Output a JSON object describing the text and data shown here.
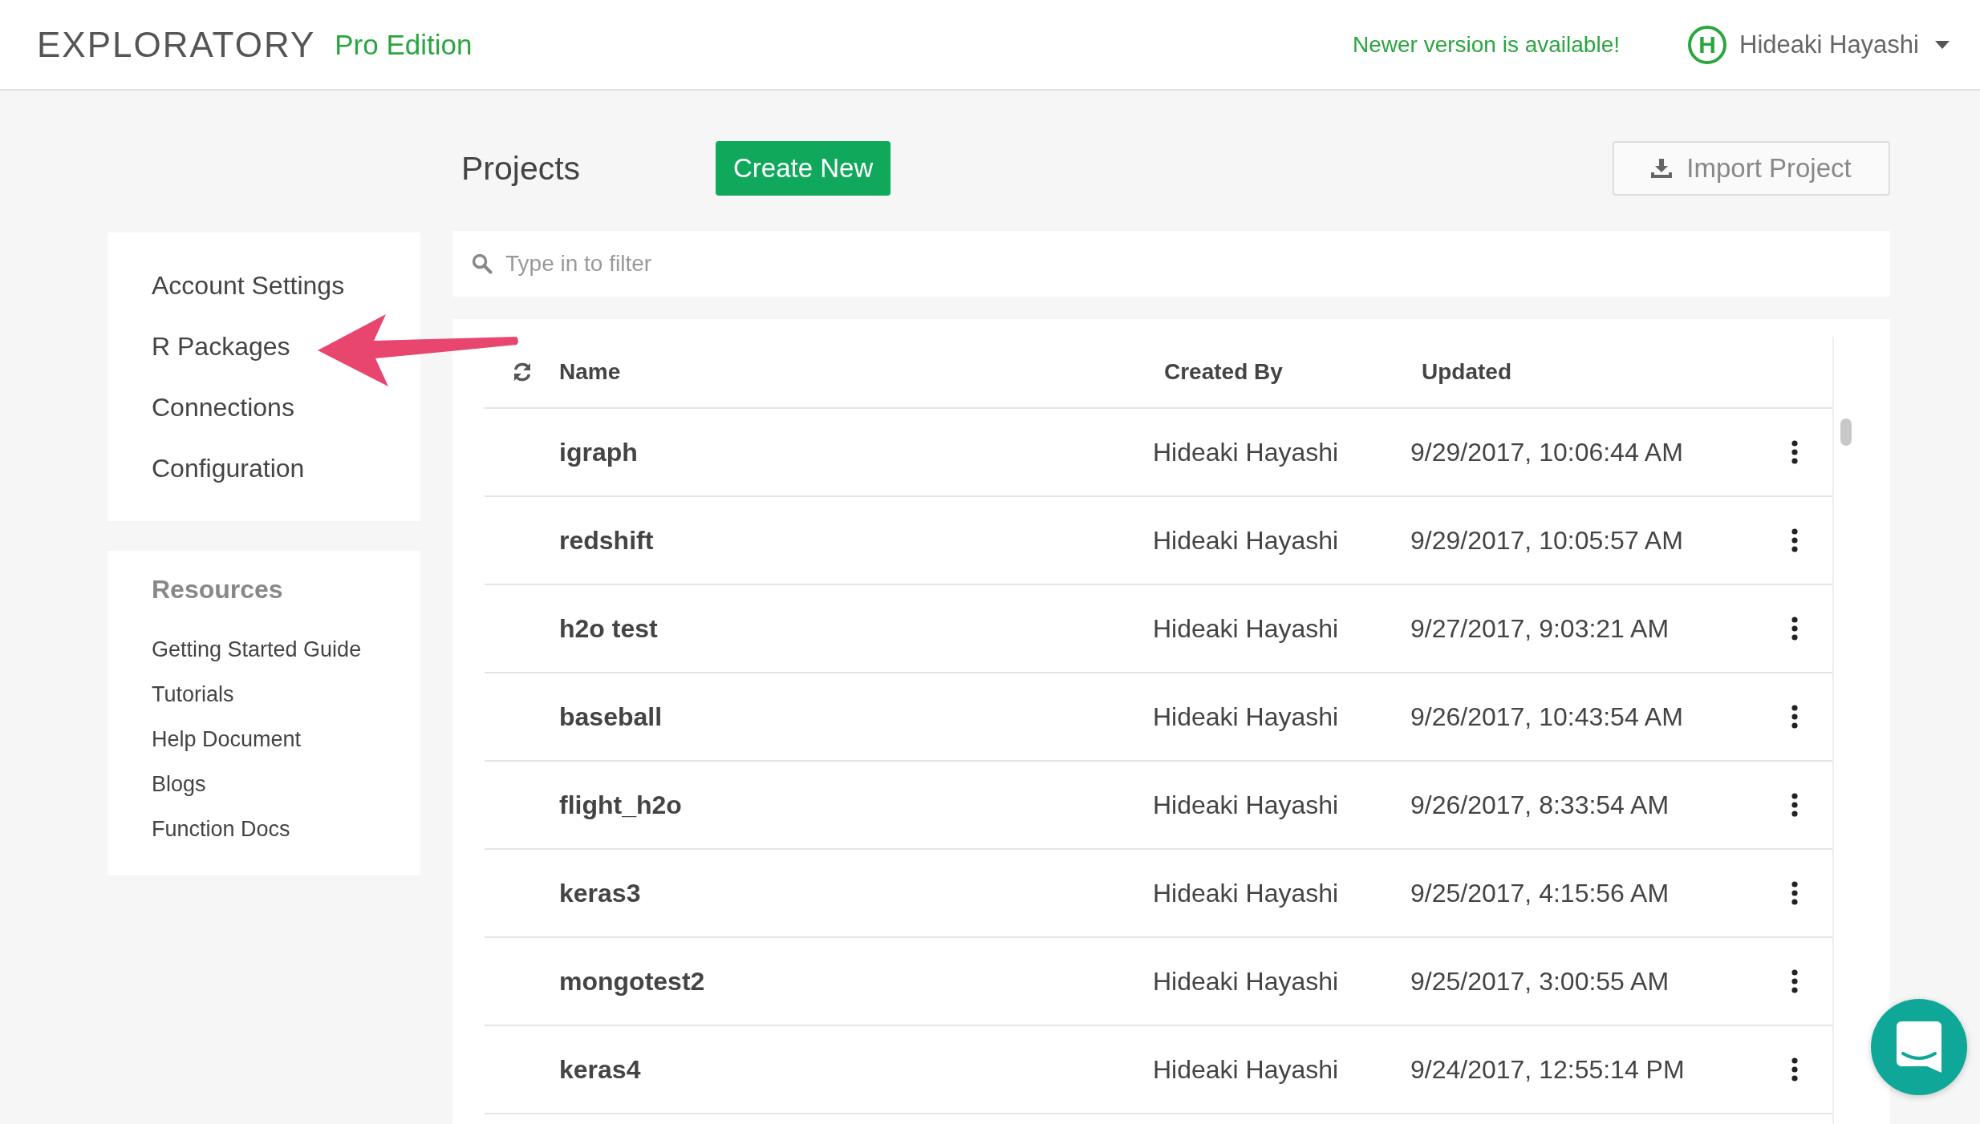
{
  "header": {
    "logo": "EXPLORATORY",
    "edition": "Pro Edition",
    "update_notice": "Newer version is available!",
    "user": {
      "initial": "H",
      "name": "Hideaki Hayashi"
    }
  },
  "page_title": "Projects",
  "create_button": "Create New",
  "import_button": "Import Project",
  "settings_menu": [
    "Account Settings",
    "R Packages",
    "Connections",
    "Configuration"
  ],
  "resources": {
    "heading": "Resources",
    "links": [
      "Getting Started Guide",
      "Tutorials",
      "Help Document",
      "Blogs",
      "Function Docs"
    ]
  },
  "filter": {
    "placeholder": "Type in to filter"
  },
  "table": {
    "columns": [
      "Name",
      "Created By",
      "Updated"
    ],
    "rows": [
      {
        "name": "igraph",
        "created_by": "Hideaki Hayashi",
        "updated": "9/29/2017, 10:06:44 AM"
      },
      {
        "name": "redshift",
        "created_by": "Hideaki Hayashi",
        "updated": "9/29/2017, 10:05:57 AM"
      },
      {
        "name": "h2o test",
        "created_by": "Hideaki Hayashi",
        "updated": "9/27/2017, 9:03:21 AM"
      },
      {
        "name": "baseball",
        "created_by": "Hideaki Hayashi",
        "updated": "9/26/2017, 10:43:54 AM"
      },
      {
        "name": "flight_h2o",
        "created_by": "Hideaki Hayashi",
        "updated": "9/26/2017, 8:33:54 AM"
      },
      {
        "name": "keras3",
        "created_by": "Hideaki Hayashi",
        "updated": "9/25/2017, 4:15:56 AM"
      },
      {
        "name": "mongotest2",
        "created_by": "Hideaki Hayashi",
        "updated": "9/25/2017, 3:00:55 AM"
      },
      {
        "name": "keras4",
        "created_by": "Hideaki Hayashi",
        "updated": "9/24/2017, 12:55:14 PM"
      }
    ]
  }
}
